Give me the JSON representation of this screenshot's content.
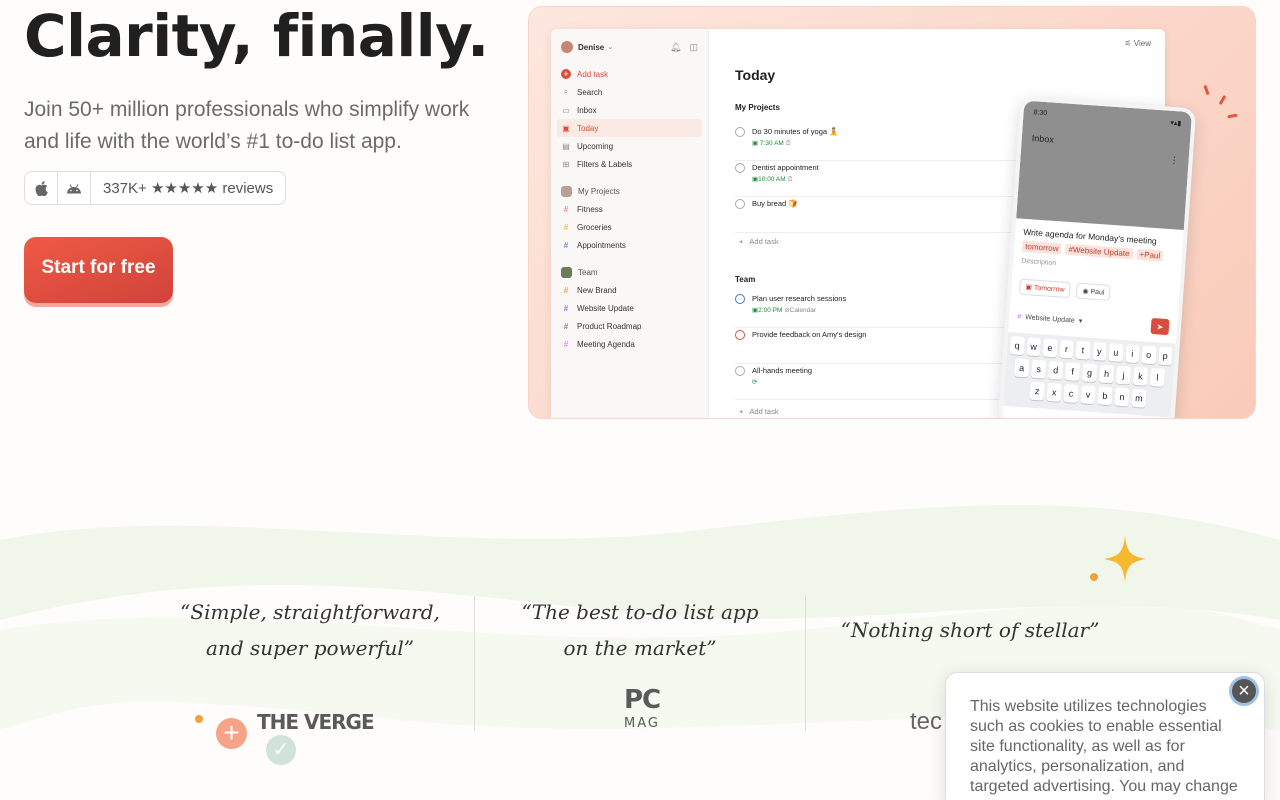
{
  "hero": {
    "title": "Clarity, finally.",
    "subtitle": "Join 50+ million professionals who simplify work and life with the world’s #1 to-do list app.",
    "reviews": "337K+ ★★★★★ reviews",
    "cta": "Start for free",
    "platform_icons": [
      "apple-icon",
      "android-icon"
    ]
  },
  "app": {
    "user": "Denise",
    "view_label": "View",
    "nav": [
      {
        "label": "Add task",
        "icon": "plus-icon"
      },
      {
        "label": "Search",
        "icon": "search-icon"
      },
      {
        "label": "Inbox",
        "icon": "inbox-icon"
      },
      {
        "label": "Today",
        "icon": "calendar-icon"
      },
      {
        "label": "Upcoming",
        "icon": "calendar-icon"
      },
      {
        "label": "Filters & Labels",
        "icon": "grid-icon"
      }
    ],
    "my_projects_label": "My Projects",
    "projects": [
      "Fitness",
      "Groceries",
      "Appointments"
    ],
    "team_label": "Team",
    "team_projects": [
      "New Brand",
      "Website Update",
      "Product Roadmap",
      "Meeting Agenda"
    ],
    "main_title": "Today",
    "group1": "My Projects",
    "tasks1": [
      {
        "name": "Do 30 minutes of yoga 🧘",
        "meta": "7:30 AM"
      },
      {
        "name": "Dentist appointment",
        "meta": "10:00 AM"
      },
      {
        "name": "Buy bread 🍞",
        "meta": ""
      }
    ],
    "add_task": "Add task",
    "group2": "Team",
    "tasks2": [
      {
        "name": "Plan user research sessions",
        "meta": "2:00 PM",
        "extra": "Calendar"
      },
      {
        "name": "Provide feedback on Amy's design",
        "meta": ""
      },
      {
        "name": "All-hands meeting",
        "meta": ""
      }
    ]
  },
  "phone": {
    "time": "8:30",
    "title": "Inbox",
    "task": "Write agenda for Monday's meeting",
    "tags": [
      "tomorrow",
      "#Website Update",
      "+Paul"
    ],
    "description": "Description",
    "chip_date": "Tomorrow",
    "chip_person": "Paul",
    "project": "Website Update",
    "kbd_rows": [
      [
        "q",
        "w",
        "e",
        "r",
        "t",
        "y",
        "u",
        "i",
        "o",
        "p"
      ],
      [
        "a",
        "s",
        "d",
        "f",
        "g",
        "h",
        "j",
        "k",
        "l"
      ],
      [
        "z",
        "x",
        "c",
        "v",
        "b",
        "n",
        "m"
      ]
    ]
  },
  "testimonials": [
    {
      "line1": "“Simple, straightforward,",
      "line2": "and super powerful”",
      "source": "THE VERGE"
    },
    {
      "line1": "“The best to-do list app",
      "line2": "on the market”",
      "source_top": "PC",
      "source_bottom": "MAG"
    },
    {
      "line1": "“Nothing short of stellar”",
      "source": "tec"
    }
  ],
  "cookie": {
    "text": "This website utilizes technologies such as cookies to enable essential site functionality, as well as for analytics, personalization, and targeted advertising. You may change",
    "close_icon": "close-icon"
  }
}
